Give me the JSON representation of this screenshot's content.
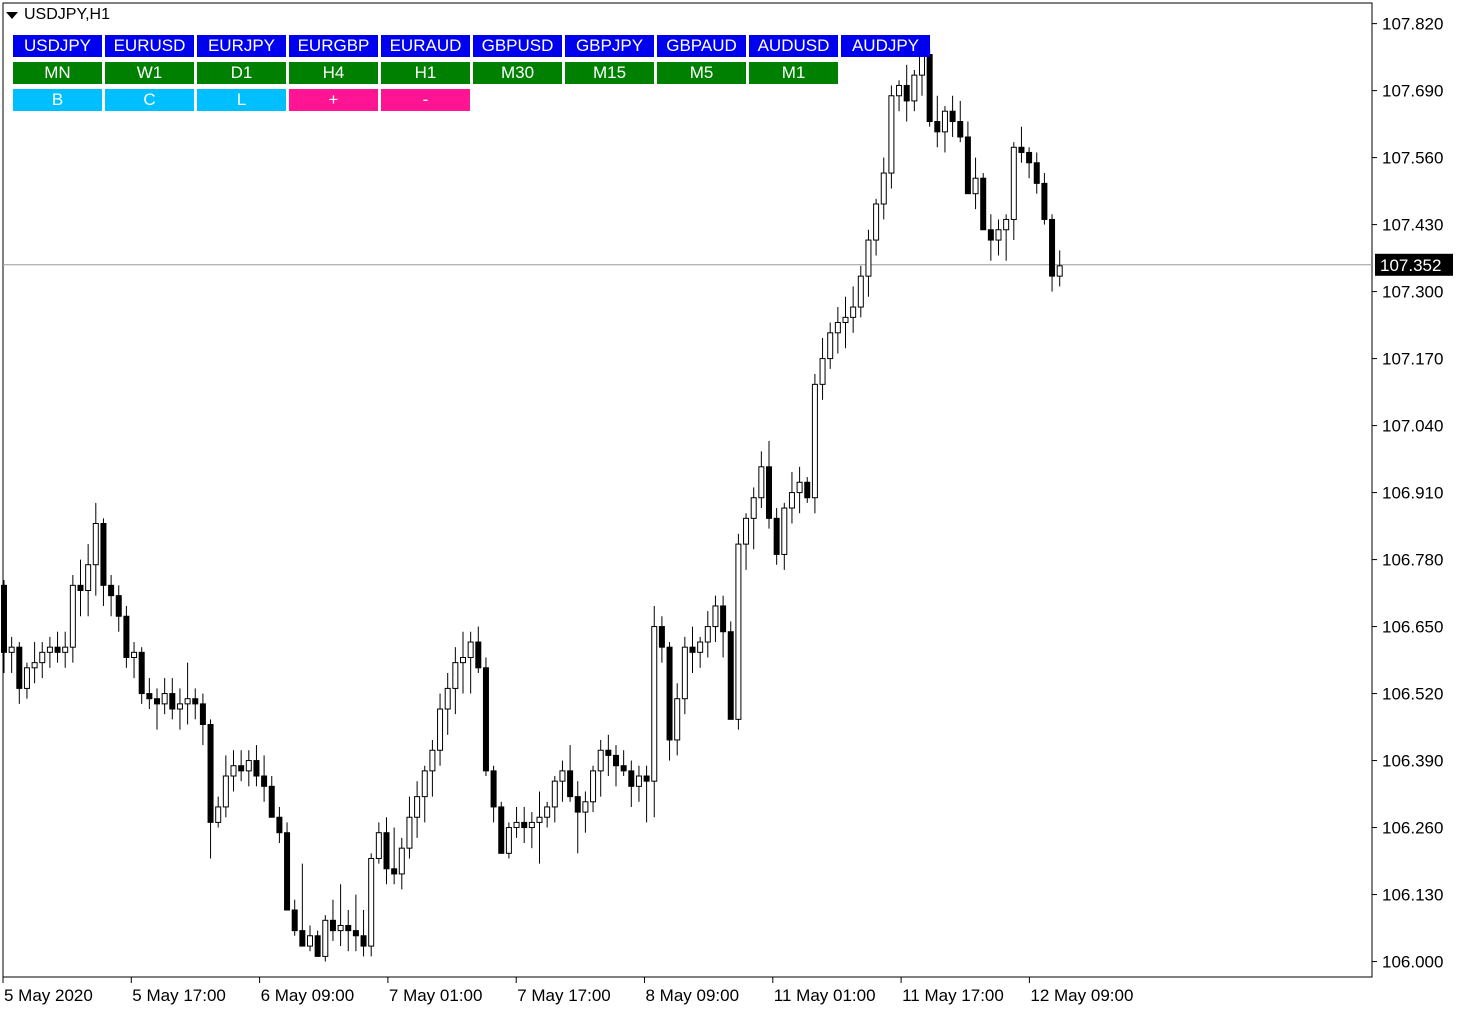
{
  "header": {
    "title": "USDJPY,H1"
  },
  "symbols": [
    "USDJPY",
    "EURUSD",
    "EURJPY",
    "EURGBP",
    "EURAUD",
    "GBPUSD",
    "GBPJPY",
    "GBPAUD",
    "AUDUSD",
    "AUDJPY"
  ],
  "timeframes": [
    "MN",
    "W1",
    "D1",
    "H4",
    "H1",
    "M30",
    "M15",
    "M5",
    "M1"
  ],
  "controls": [
    {
      "label": "B",
      "color": "blue"
    },
    {
      "label": "C",
      "color": "blue"
    },
    {
      "label": "L",
      "color": "blue"
    },
    {
      "label": "+",
      "color": "pink"
    },
    {
      "label": "-",
      "color": "pink"
    }
  ],
  "chart_data": {
    "type": "candlestick",
    "symbol": "USDJPY",
    "timeframe": "H1",
    "current_price": 107.352,
    "current_price_label": "107.352",
    "ylim": [
      105.97,
      107.86
    ],
    "y_ticks": [
      "107.820",
      "107.690",
      "107.560",
      "107.430",
      "107.300",
      "107.170",
      "107.040",
      "106.910",
      "106.780",
      "106.650",
      "106.520",
      "106.390",
      "106.260",
      "106.130",
      "106.000"
    ],
    "x_ticks": [
      "5 May 2020",
      "5 May 17:00",
      "6 May 09:00",
      "7 May 01:00",
      "7 May 17:00",
      "8 May 09:00",
      "11 May 01:00",
      "11 May 17:00",
      "12 May 09:00"
    ],
    "candles": [
      [
        106.73,
        106.74,
        106.56,
        106.6
      ],
      [
        106.6,
        106.63,
        106.56,
        106.61
      ],
      [
        106.61,
        106.62,
        106.5,
        106.53
      ],
      [
        106.53,
        106.58,
        106.51,
        106.57
      ],
      [
        106.57,
        106.62,
        106.54,
        106.58
      ],
      [
        106.58,
        106.62,
        106.55,
        106.6
      ],
      [
        106.6,
        106.63,
        106.57,
        106.61
      ],
      [
        106.61,
        106.64,
        106.58,
        106.6
      ],
      [
        106.6,
        106.64,
        106.57,
        106.61
      ],
      [
        106.61,
        106.75,
        106.58,
        106.73
      ],
      [
        106.73,
        106.78,
        106.67,
        106.72
      ],
      [
        106.72,
        106.81,
        106.67,
        106.77
      ],
      [
        106.77,
        106.89,
        106.71,
        106.85
      ],
      [
        106.85,
        106.86,
        106.69,
        106.73
      ],
      [
        106.73,
        106.75,
        106.67,
        106.71
      ],
      [
        106.71,
        106.73,
        106.64,
        106.67
      ],
      [
        106.67,
        106.69,
        106.57,
        106.59
      ],
      [
        106.59,
        106.62,
        106.55,
        106.6
      ],
      [
        106.6,
        106.61,
        106.5,
        106.52
      ],
      [
        106.52,
        106.55,
        106.49,
        106.51
      ],
      [
        106.51,
        106.53,
        106.45,
        106.5
      ],
      [
        106.5,
        106.55,
        106.48,
        106.52
      ],
      [
        106.52,
        106.55,
        106.47,
        106.49
      ],
      [
        106.49,
        106.53,
        106.45,
        106.5
      ],
      [
        106.5,
        106.58,
        106.46,
        106.51
      ],
      [
        106.51,
        106.53,
        106.47,
        106.5
      ],
      [
        106.5,
        106.52,
        106.42,
        106.46
      ],
      [
        106.46,
        106.47,
        106.2,
        106.27
      ],
      [
        106.27,
        106.32,
        106.26,
        106.3
      ],
      [
        106.3,
        106.4,
        106.28,
        106.36
      ],
      [
        106.36,
        106.41,
        106.33,
        106.38
      ],
      [
        106.38,
        106.41,
        106.35,
        106.37
      ],
      [
        106.37,
        106.41,
        106.34,
        106.39
      ],
      [
        106.39,
        106.42,
        106.34,
        106.36
      ],
      [
        106.36,
        106.4,
        106.31,
        106.34
      ],
      [
        106.34,
        106.36,
        106.28,
        106.28
      ],
      [
        106.28,
        106.3,
        106.23,
        106.25
      ],
      [
        106.25,
        106.27,
        106.11,
        106.1
      ],
      [
        106.1,
        106.12,
        106.05,
        106.06
      ],
      [
        106.06,
        106.19,
        106.04,
        106.03
      ],
      [
        106.03,
        106.07,
        106.02,
        106.05
      ],
      [
        106.05,
        106.06,
        106.01,
        106.01
      ],
      [
        106.01,
        106.09,
        106.0,
        106.08
      ],
      [
        106.08,
        106.12,
        106.04,
        106.06
      ],
      [
        106.06,
        106.15,
        106.03,
        106.07
      ],
      [
        106.07,
        106.1,
        106.02,
        106.06
      ],
      [
        106.06,
        106.13,
        106.02,
        106.05
      ],
      [
        106.05,
        106.1,
        106.01,
        106.03
      ],
      [
        106.03,
        106.21,
        106.01,
        106.2
      ],
      [
        106.2,
        106.27,
        106.19,
        106.25
      ],
      [
        106.25,
        106.28,
        106.15,
        106.18
      ],
      [
        106.18,
        106.26,
        106.15,
        106.17
      ],
      [
        106.17,
        106.24,
        106.14,
        106.22
      ],
      [
        106.22,
        106.32,
        106.2,
        106.28
      ],
      [
        106.28,
        106.35,
        106.24,
        106.32
      ],
      [
        106.32,
        106.38,
        106.27,
        106.37
      ],
      [
        106.37,
        106.43,
        106.32,
        106.41
      ],
      [
        106.41,
        106.52,
        106.38,
        106.49
      ],
      [
        106.49,
        106.56,
        106.44,
        106.53
      ],
      [
        106.53,
        106.61,
        106.48,
        106.58
      ],
      [
        106.58,
        106.64,
        106.52,
        106.59
      ],
      [
        106.59,
        106.64,
        106.52,
        106.62
      ],
      [
        106.62,
        106.65,
        106.56,
        106.57
      ],
      [
        106.57,
        106.59,
        106.36,
        106.37
      ],
      [
        106.37,
        106.38,
        106.27,
        106.3
      ],
      [
        106.3,
        106.31,
        106.21,
        106.21
      ],
      [
        106.21,
        106.27,
        106.2,
        106.26
      ],
      [
        106.26,
        106.3,
        106.24,
        106.27
      ],
      [
        106.27,
        106.3,
        106.23,
        106.26
      ],
      [
        106.26,
        106.29,
        106.22,
        106.27
      ],
      [
        106.27,
        106.33,
        106.19,
        106.28
      ],
      [
        106.28,
        106.31,
        106.26,
        106.3
      ],
      [
        106.3,
        106.36,
        106.27,
        106.35
      ],
      [
        106.35,
        106.39,
        106.31,
        106.37
      ],
      [
        106.37,
        106.42,
        106.31,
        106.32
      ],
      [
        106.32,
        106.35,
        106.21,
        106.29
      ],
      [
        106.29,
        106.33,
        106.25,
        106.31
      ],
      [
        106.31,
        106.38,
        106.29,
        106.37
      ],
      [
        106.37,
        106.43,
        106.32,
        106.41
      ],
      [
        106.41,
        106.44,
        106.36,
        106.4
      ],
      [
        106.4,
        106.42,
        106.34,
        106.38
      ],
      [
        106.38,
        106.41,
        106.36,
        106.37
      ],
      [
        106.37,
        106.39,
        106.3,
        106.34
      ],
      [
        106.34,
        106.38,
        106.31,
        106.36
      ],
      [
        106.36,
        106.38,
        106.27,
        106.35
      ],
      [
        106.35,
        106.69,
        106.28,
        106.65
      ],
      [
        106.65,
        106.67,
        106.58,
        106.61
      ],
      [
        106.61,
        106.62,
        106.39,
        106.43
      ],
      [
        106.43,
        106.54,
        106.4,
        106.51
      ],
      [
        106.51,
        106.63,
        106.48,
        106.61
      ],
      [
        106.61,
        106.65,
        106.56,
        106.6
      ],
      [
        106.6,
        106.63,
        106.57,
        106.62
      ],
      [
        106.62,
        106.68,
        106.59,
        106.65
      ],
      [
        106.65,
        106.71,
        106.62,
        106.69
      ],
      [
        106.69,
        106.71,
        106.59,
        106.64
      ],
      [
        106.64,
        106.66,
        106.47,
        106.47
      ],
      [
        106.47,
        106.83,
        106.45,
        106.81
      ],
      [
        106.81,
        106.87,
        106.76,
        106.86
      ],
      [
        106.86,
        106.92,
        106.8,
        106.9
      ],
      [
        106.9,
        106.99,
        106.88,
        106.96
      ],
      [
        106.96,
        107.01,
        106.84,
        106.86
      ],
      [
        106.86,
        106.88,
        106.77,
        106.79
      ],
      [
        106.79,
        106.89,
        106.76,
        106.88
      ],
      [
        106.88,
        106.95,
        106.85,
        106.91
      ],
      [
        106.91,
        106.96,
        106.87,
        106.93
      ],
      [
        106.93,
        106.94,
        106.89,
        106.9
      ],
      [
        106.9,
        107.14,
        106.87,
        107.12
      ],
      [
        107.12,
        107.21,
        107.09,
        107.17
      ],
      [
        107.17,
        107.24,
        107.15,
        107.22
      ],
      [
        107.22,
        107.27,
        107.18,
        107.24
      ],
      [
        107.24,
        107.29,
        107.19,
        107.25
      ],
      [
        107.25,
        107.31,
        107.22,
        107.27
      ],
      [
        107.27,
        107.35,
        107.25,
        107.33
      ],
      [
        107.33,
        107.42,
        107.29,
        107.4
      ],
      [
        107.4,
        107.48,
        107.37,
        107.47
      ],
      [
        107.47,
        107.56,
        107.44,
        107.53
      ],
      [
        107.53,
        107.7,
        107.5,
        107.68
      ],
      [
        107.68,
        107.71,
        107.65,
        107.7
      ],
      [
        107.7,
        107.74,
        107.63,
        107.67
      ],
      [
        107.67,
        107.73,
        107.65,
        107.72
      ],
      [
        107.72,
        107.77,
        107.68,
        107.76
      ],
      [
        107.76,
        107.77,
        107.62,
        107.63
      ],
      [
        107.63,
        107.68,
        107.58,
        107.61
      ],
      [
        107.61,
        107.66,
        107.57,
        107.65
      ],
      [
        107.65,
        107.68,
        107.6,
        107.63
      ],
      [
        107.63,
        107.67,
        107.59,
        107.6
      ],
      [
        107.6,
        107.63,
        107.49,
        107.49
      ],
      [
        107.49,
        107.56,
        107.46,
        107.52
      ],
      [
        107.52,
        107.53,
        107.42,
        107.42
      ],
      [
        107.42,
        107.45,
        107.36,
        107.4
      ],
      [
        107.4,
        107.44,
        107.37,
        107.42
      ],
      [
        107.42,
        107.45,
        107.36,
        107.44
      ],
      [
        107.44,
        107.59,
        107.4,
        107.58
      ],
      [
        107.58,
        107.62,
        107.55,
        107.57
      ],
      [
        107.57,
        107.58,
        107.52,
        107.55
      ],
      [
        107.55,
        107.57,
        107.49,
        107.51
      ],
      [
        107.51,
        107.53,
        107.43,
        107.44
      ],
      [
        107.44,
        107.45,
        107.3,
        107.33
      ],
      [
        107.33,
        107.38,
        107.31,
        107.35
      ]
    ]
  }
}
